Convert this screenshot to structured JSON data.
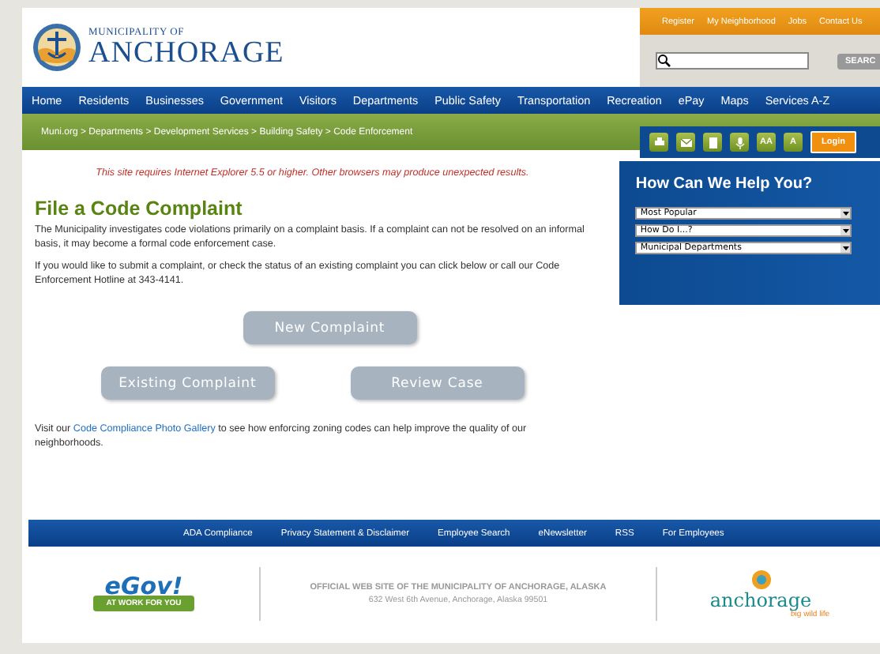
{
  "logo": {
    "top": "MUNICIPALITY OF",
    "name": "ANCHORAGE"
  },
  "top_links": [
    "Register",
    "My Neighborhood",
    "Jobs",
    "Contact Us"
  ],
  "search": {
    "button": "SEARC"
  },
  "nav": [
    "Home",
    "Residents",
    "Businesses",
    "Government",
    "Visitors",
    "Departments",
    "Public Safety",
    "Transportation",
    "Recreation",
    "ePay",
    "Maps",
    "Services A-Z"
  ],
  "breadcrumb": "Muni.org > Departments > Development Services > Building Safety > Code Enforcement",
  "toolbar": [
    {
      "kind": "print"
    },
    {
      "kind": "email"
    },
    {
      "kind": "document"
    },
    {
      "kind": "microphone"
    },
    {
      "kind": "text",
      "label": "AA"
    },
    {
      "kind": "text",
      "label": "A"
    },
    {
      "kind": "login",
      "label": "Login"
    }
  ],
  "notice": "This site requires Internet Explorer 5.5 or higher.  Other browsers may produce unexpected results.",
  "heading": "File a Code Complaint",
  "paragraphs": [
    "The Municipality investigates code violations primarily on a complaint basis.  If a complaint can not be resolved on an informal basis, it may become a formal code enforcement case.",
    "If you would like to submit a complaint, or check the status of an existing complaint you can click below or call our Code Enforcement Hotline at 343-4141."
  ],
  "buttons": [
    [
      "New Complaint"
    ],
    [
      "Existing Complaint",
      "Review Case"
    ]
  ],
  "gallery": {
    "before": "Visit our ",
    "link": "Code Compliance Photo Gallery",
    "after": " to see how enforcing zoning codes can help improve the quality of our neighborhoods."
  },
  "help": {
    "title": "How Can We Help You?",
    "selects": [
      "Most Popular",
      "How Do I...?",
      "Municipal Departments"
    ]
  },
  "footer_links": [
    "ADA Compliance",
    "Privacy Statement & Disclaimer",
    "Employee Search",
    "eNewsletter",
    "RSS",
    "For Employees"
  ],
  "egov": {
    "title": "eGov!",
    "ribbon": "AT WORK FOR YOU"
  },
  "official": {
    "title": "OFFICIAL WEB SITE OF THE MUNICIPALITY OF ANCHORAGE, ALASKA",
    "address": "632 West 6th Avenue, Anchorage, Alaska 99501"
  },
  "brand": {
    "name": "anchorage",
    "tagline": "big wild life"
  }
}
